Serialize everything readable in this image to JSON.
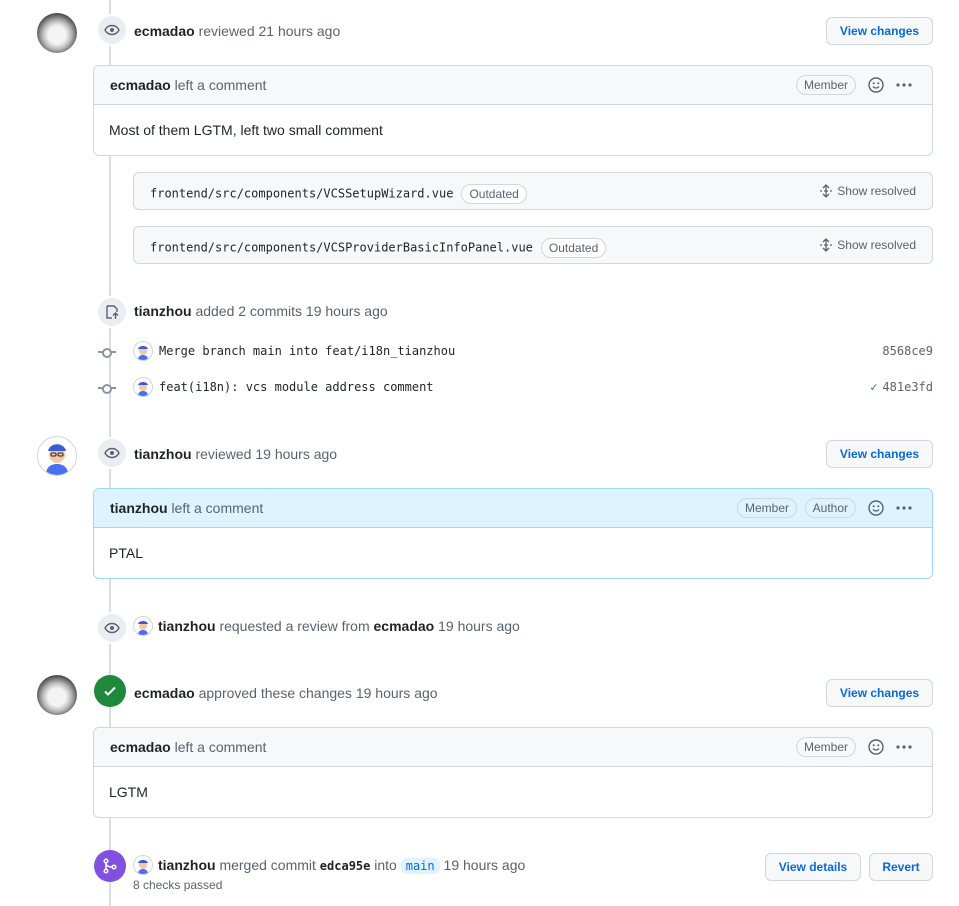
{
  "review1": {
    "user": "ecmadao",
    "action": "reviewed 21 hours ago",
    "button": "View changes",
    "comment": {
      "user": "ecmadao",
      "action": "left a comment",
      "labels": [
        "Member"
      ],
      "body": "Most of them LGTM, left two small comment"
    },
    "files": [
      {
        "path": "frontend/src/components/VCSSetupWizard.vue",
        "badge": "Outdated",
        "action": "Show resolved"
      },
      {
        "path": "frontend/src/components/VCSProviderBasicInfoPanel.vue",
        "badge": "Outdated",
        "action": "Show resolved"
      }
    ]
  },
  "commits_event": {
    "user": "tianzhou",
    "action": "added 2 commits 19 hours ago",
    "commits": [
      {
        "message": "Merge branch main into feat/i18n_tianzhou",
        "sha": "8568ce9",
        "check": ""
      },
      {
        "message": "feat(i18n): vcs module address comment",
        "sha": "481e3fd",
        "check": "✓"
      }
    ]
  },
  "review2": {
    "user": "tianzhou",
    "action": "reviewed 19 hours ago",
    "button": "View changes",
    "comment": {
      "user": "tianzhou",
      "action": "left a comment",
      "labels": [
        "Member",
        "Author"
      ],
      "body": "PTAL"
    }
  },
  "request_event": {
    "user": "tianzhou",
    "action": "requested a review from",
    "target": "ecmadao",
    "time": "19 hours ago"
  },
  "approval": {
    "user": "ecmadao",
    "action": "approved these changes 19 hours ago",
    "button": "View changes",
    "comment": {
      "user": "ecmadao",
      "action": "left a comment",
      "labels": [
        "Member"
      ],
      "body": "LGTM"
    }
  },
  "merge_event": {
    "user": "tianzhou",
    "action": "merged commit",
    "commit": "edca95e",
    "into": "into",
    "branch": "main",
    "time": "19 hours ago",
    "checks": "8 checks passed",
    "details_button": "View details",
    "revert_button": "Revert"
  },
  "colors": {
    "link": "#0969da",
    "approved": "#1f883d",
    "merged": "#8250df",
    "author_header": "#ddf4ff"
  }
}
